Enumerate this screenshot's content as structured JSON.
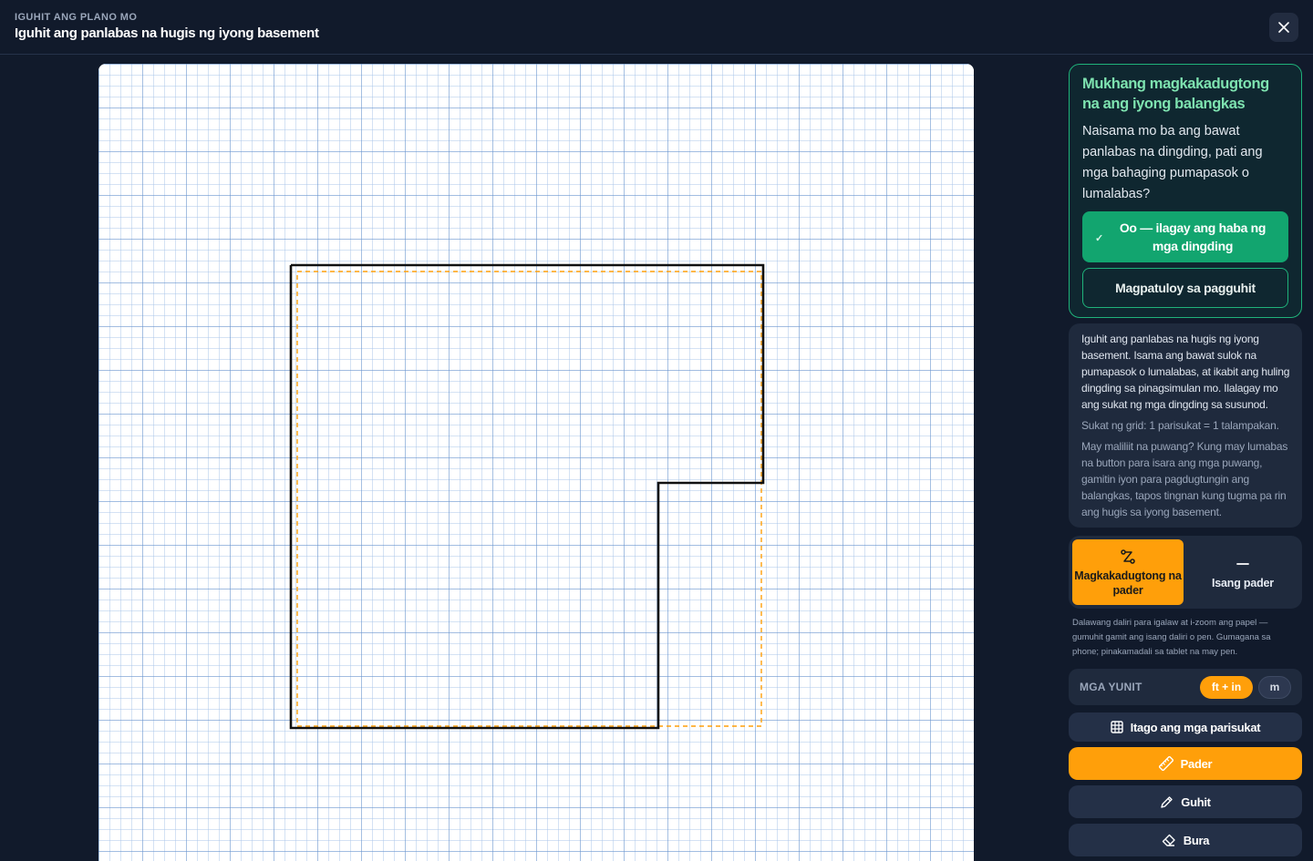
{
  "header": {
    "eyebrow": "IGUHIT ANG PLANO MO",
    "title": "Iguhit ang panlabas na hugis ng iyong basement"
  },
  "confirm_card": {
    "title": "Mukhang magkakadugtong na ang iyong balangkas",
    "body": "Naisama mo ba ang bawat panlabas na dingding, pati ang mga bahaging pumapasok o lumalabas?",
    "yes_label": "Oo — ilagay ang haba ng mga dingding",
    "yes_icon": "check-icon",
    "continue_label": "Magpatuloy sa pagguhit"
  },
  "info_card": {
    "main": "Iguhit ang panlabas na hugis ng iyong basement. Isama ang bawat sulok na pumapasok o lumalabas, at ikabit ang huling dingding sa pinagsimulan mo. Ilalagay mo ang sukat ng mga dingding sa susunod.",
    "scale": "Sukat ng grid: 1 parisukat = 1 talampakan.",
    "gaps": "May maliliit na puwang? Kung may lumabas na button para isara ang mga puwang, gamitin iyon para pagdugtungin ang balangkas, tapos tingnan kung tugma pa rin ang hugis sa iyong basement."
  },
  "modes": {
    "connected": "Magkakadugtong na pader",
    "connected_icon": "connected-walls-icon",
    "single": "Isang pader",
    "single_icon": "single-wall-icon",
    "selected": "connected"
  },
  "hint": "Dalawang daliri para igalaw at i-zoom ang papel — gumuhit gamit ang isang daliri o pen. Gumagana sa phone; pinakamadali sa tablet na may pen.",
  "units": {
    "label": "MGA YUNIT",
    "imperial": "ft + in",
    "metric": "m",
    "selected": "ft + in"
  },
  "tools": {
    "hide_grid": "Itago ang mga parisukat",
    "hide_grid_icon": "grid-icon",
    "wall": "Pader",
    "wall_icon": "ruler-icon",
    "line": "Guhit",
    "line_icon": "pencil-icon",
    "erase": "Bura",
    "erase_icon": "eraser-icon",
    "selected": "wall"
  },
  "colors": {
    "accent": "#ff9f0a",
    "success": "#12a56f",
    "background": "#111a2b",
    "grid_minor": "#aac4e8",
    "grid_major": "#6b95cf",
    "outline": "#111111",
    "snap_guide": "#ff9f0a"
  }
}
